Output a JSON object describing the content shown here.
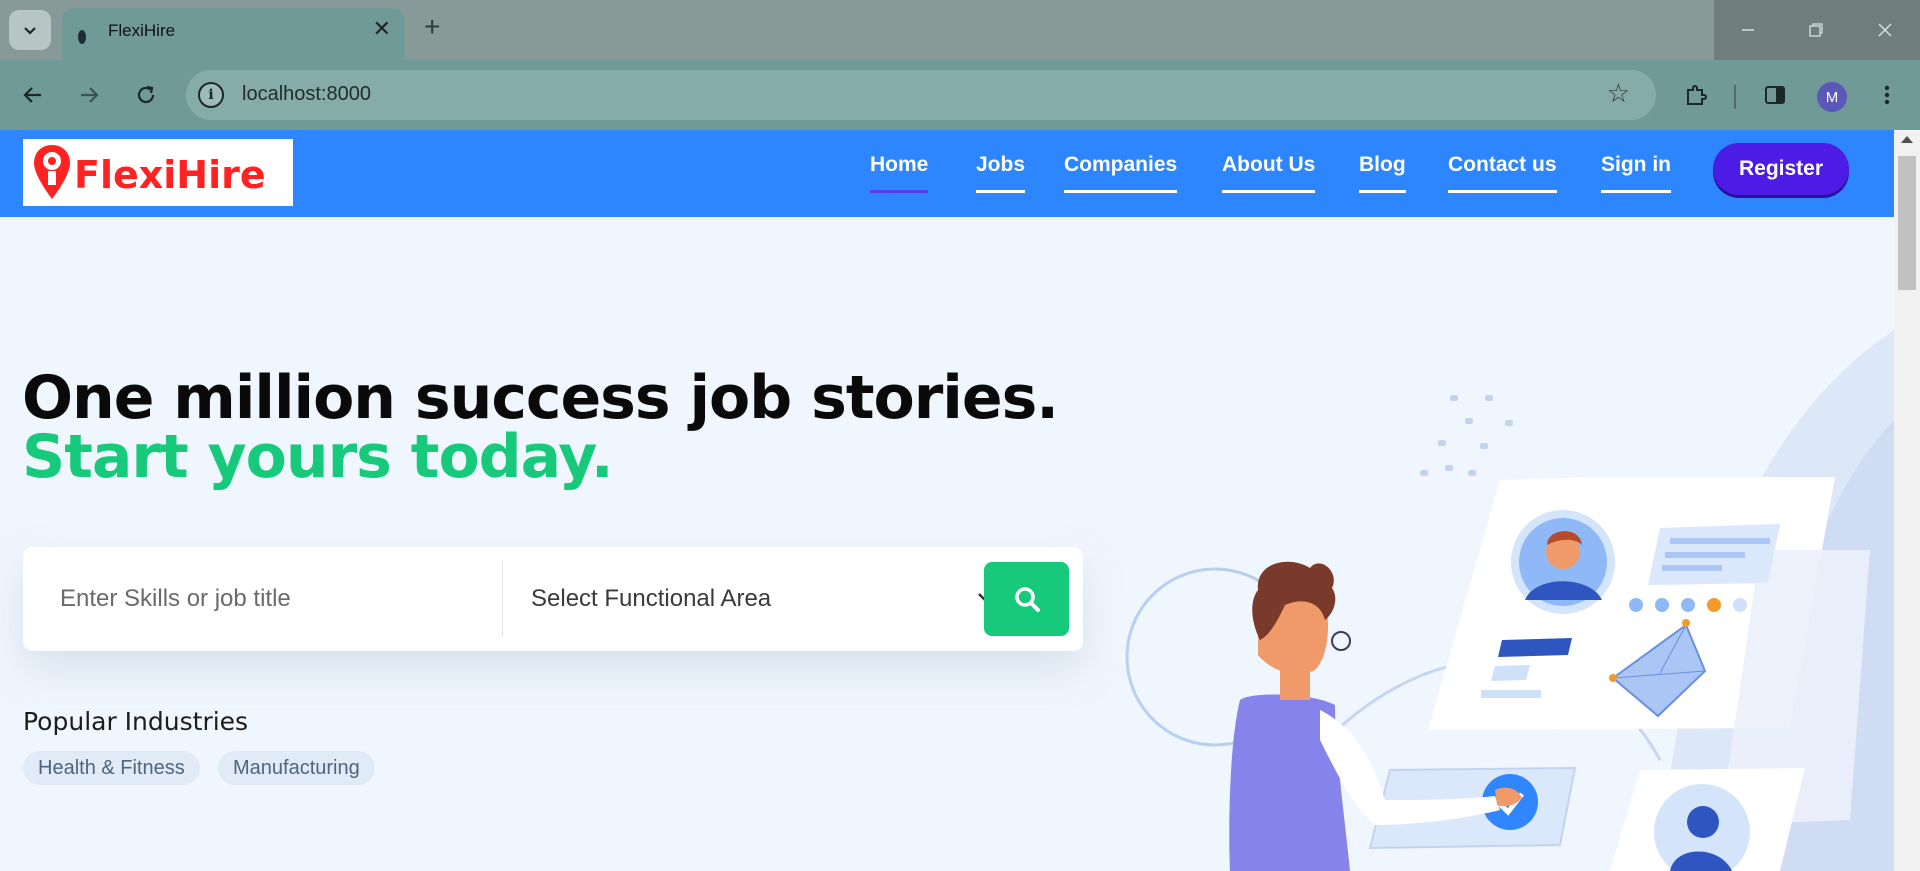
{
  "browser": {
    "tab_title": "FlexiHire",
    "url": "localhost:8000",
    "profile_initial": "M",
    "icons": {
      "tab_search": "chevron-down-icon",
      "new_tab": "plus-icon",
      "back": "arrow-left-icon",
      "forward": "arrow-right-icon",
      "reload": "reload-icon",
      "site_info": "info-icon",
      "bookmark": "star-icon",
      "extensions": "puzzle-icon",
      "side_panel": "side-panel-icon",
      "menu": "kebab-menu-icon",
      "minimize": "minimize-icon",
      "maximize": "restore-icon",
      "close": "close-icon"
    }
  },
  "header": {
    "logo_text": "FlexiHire",
    "nav": [
      {
        "label": "Home",
        "active": true
      },
      {
        "label": "Jobs",
        "active": false
      },
      {
        "label": "Companies",
        "active": false
      },
      {
        "label": "About Us",
        "active": false
      },
      {
        "label": "Blog",
        "active": false
      },
      {
        "label": "Contact us",
        "active": false
      },
      {
        "label": "Sign in",
        "active": false
      }
    ],
    "register_label": "Register"
  },
  "hero": {
    "headline": "One million success job stories.",
    "subheadline": "Start yours today."
  },
  "search": {
    "skills_placeholder": "Enter Skills or job title",
    "area_selected": "Select Functional Area",
    "button_icon": "search-icon"
  },
  "popular": {
    "title": "Popular Industries",
    "chips": [
      "Health & Fitness",
      "Manufacturing"
    ]
  },
  "colors": {
    "header_bg": "#2e86fe",
    "accent_green": "#17c97a",
    "register_purple": "#4d1be6",
    "logo_red": "#ff2222",
    "page_bg": "#f0f6fd"
  }
}
